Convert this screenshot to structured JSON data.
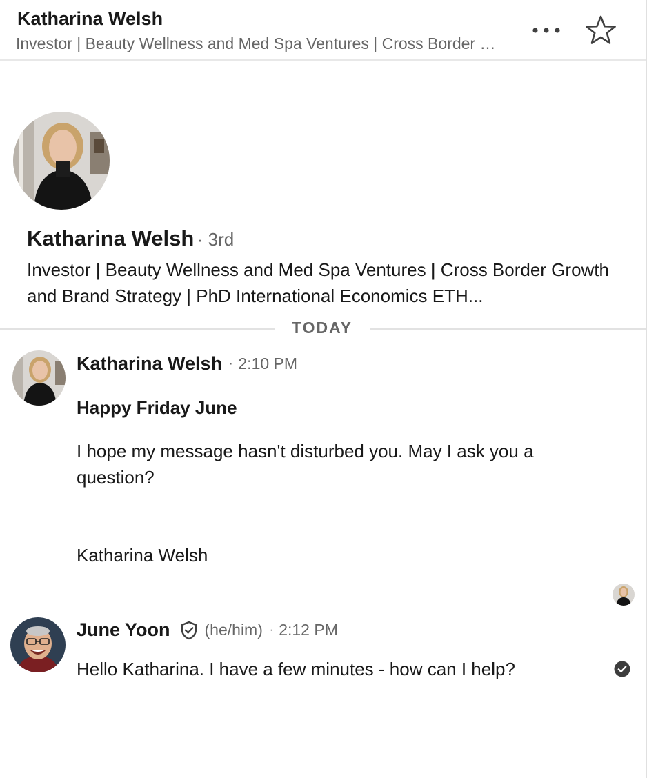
{
  "header": {
    "name": "Katharina Welsh",
    "headline": "Investor | Beauty Wellness and Med Spa Ventures | Cross Border Growth and Brand Strategy | PhD International Economics ETH...",
    "more_icon": "more-horizontal-icon",
    "star_icon": "star-outline-icon"
  },
  "profile": {
    "name": "Katharina Welsh",
    "degree": "· 3rd",
    "headline": "Investor | Beauty Wellness and Med Spa Ventures | Cross Border Growth and Brand Strategy | PhD International Economics ETH..."
  },
  "divider": {
    "label": "TODAY"
  },
  "messages": [
    {
      "sender": "Katharina Welsh",
      "separator": "·",
      "time": "2:10 PM",
      "greeting": "Happy Friday June",
      "body": "I hope my message hasn't disturbed you. May I ask you a question?",
      "signature": "Katharina Welsh"
    },
    {
      "sender": "June Yoon",
      "verified_icon": "verified-shield-icon",
      "pronouns": "(he/him)",
      "separator": "·",
      "time": "2:12 PM",
      "body": "Hello Katharina. I have a few minutes - how can I help?"
    }
  ],
  "status": {
    "seen_icon": "seen-avatar",
    "sent_icon": "sent-checkmark-icon"
  },
  "colors": {
    "primary_text": "#191919",
    "secondary_text": "#666666",
    "divider": "#e2e2e2",
    "icon": "#404040"
  }
}
